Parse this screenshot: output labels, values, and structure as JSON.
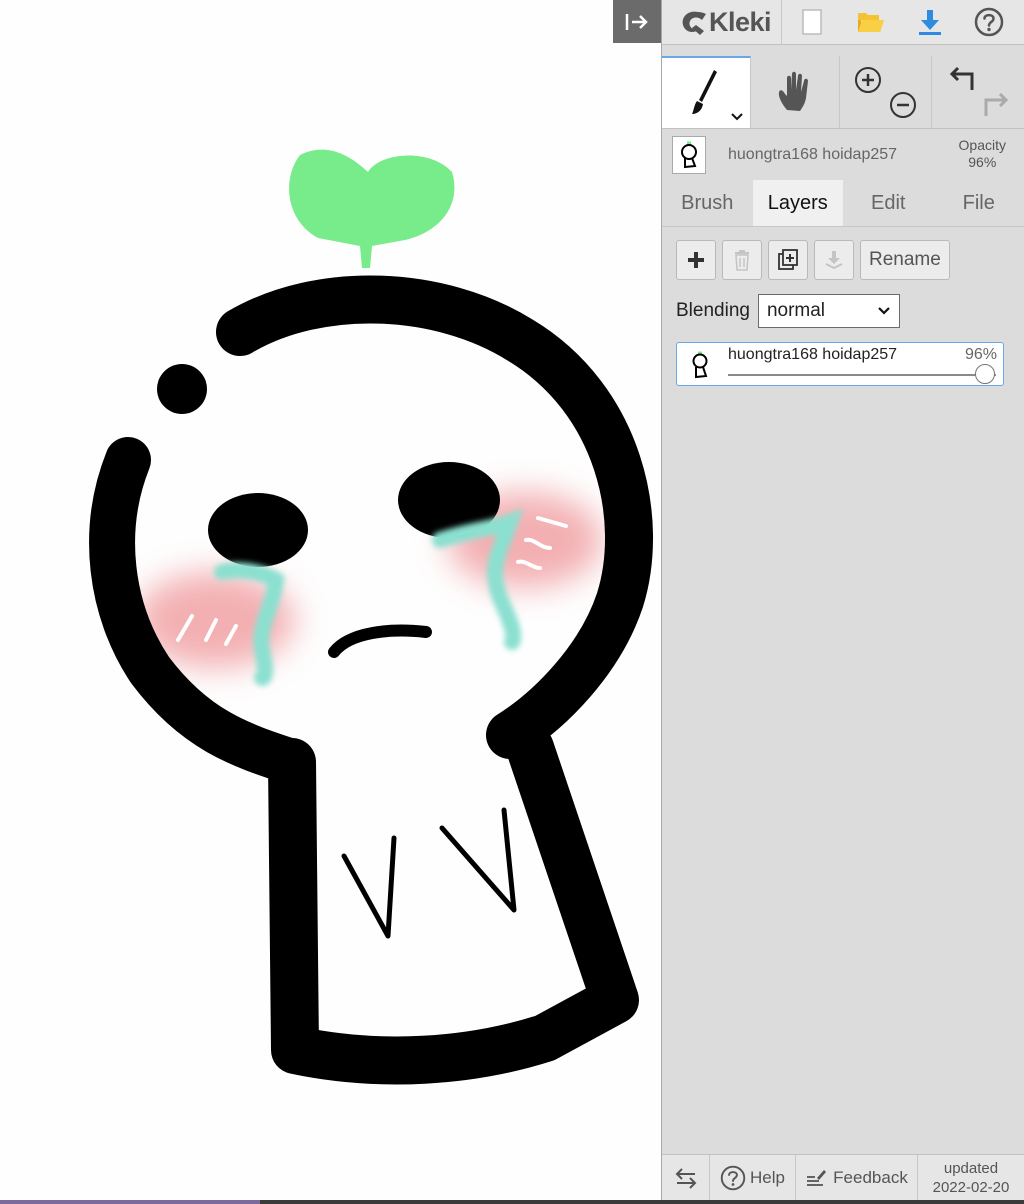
{
  "app": {
    "name": "Kleki"
  },
  "layer": {
    "name": "huongtra168 hoidap257",
    "opacity_label": "Opacity",
    "opacity_value": "96%",
    "opacity_fraction": 0.96
  },
  "tabs": [
    {
      "label": "Brush",
      "active": false
    },
    {
      "label": "Layers",
      "active": true
    },
    {
      "label": "Edit",
      "active": false
    },
    {
      "label": "File",
      "active": false
    }
  ],
  "layers_panel": {
    "rename_label": "Rename",
    "blending_label": "Blending",
    "blending_value": "normal"
  },
  "footer": {
    "help_label": "Help",
    "feedback_label": "Feedback",
    "updated_label": "updated",
    "updated_date": "2022-02-20"
  },
  "colors": {
    "accent": "#2f8be0",
    "panel": "#dcdcdc",
    "sprout": "#78ec8a",
    "tears": "#8be0d0",
    "blush": "#f2a7aa"
  }
}
